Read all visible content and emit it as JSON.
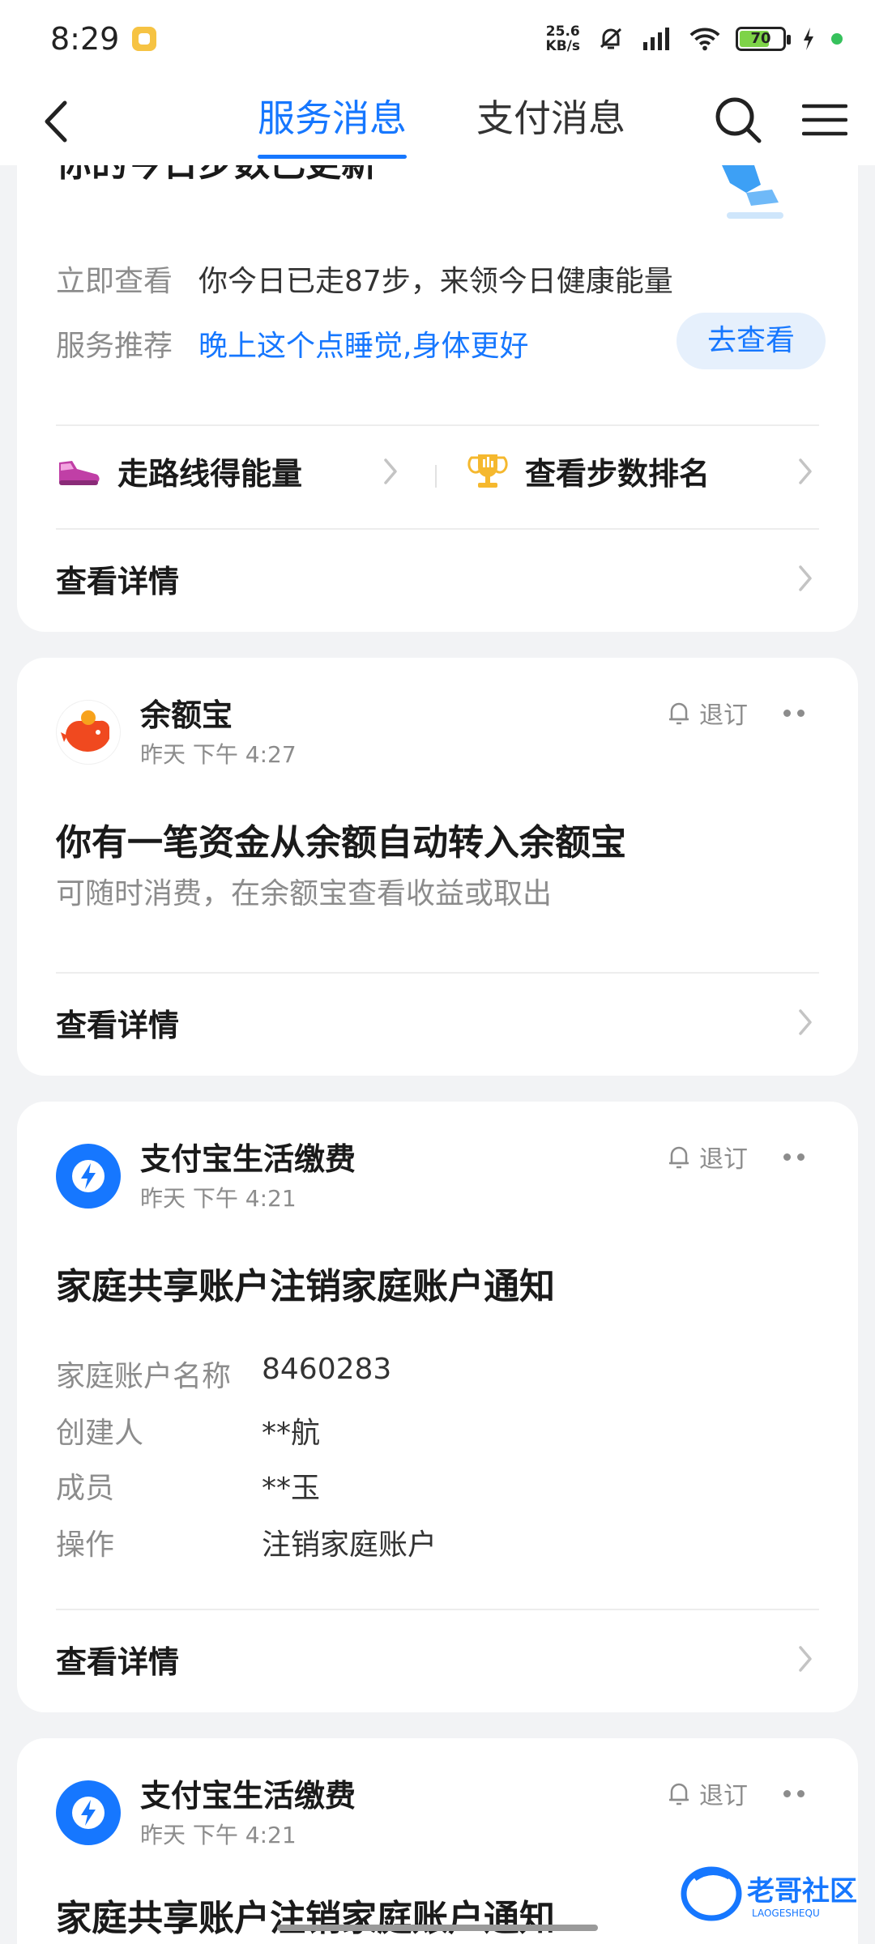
{
  "status_bar": {
    "time": "8:29",
    "net_speed_value": "25.6",
    "net_speed_unit": "KB/s",
    "battery": "70"
  },
  "header": {
    "tabs": [
      {
        "label": "服务消息",
        "active": true
      },
      {
        "label": "支付消息",
        "active": false
      }
    ]
  },
  "card_steps": {
    "title": "你的今日步数已更新",
    "rows": [
      {
        "key": "立即查看",
        "value": "你今日已走87步，来领今日健康能量"
      },
      {
        "key": "服务推荐",
        "value": "晚上这个点睡觉,身体更好"
      }
    ],
    "button": "去查看",
    "shortcuts": [
      {
        "label": "走路线得能量",
        "icon": "sneaker-icon"
      },
      {
        "label": "查看步数排名",
        "icon": "trophy-icon"
      }
    ],
    "detail": "查看详情"
  },
  "card_yuebao": {
    "brand": "余额宝",
    "time": "昨天 下午 4:27",
    "unsubscribe": "退订",
    "title": "你有一笔资金从余额自动转入余额宝",
    "subtitle": "可随时消费，在余额宝查看收益或取出",
    "detail": "查看详情"
  },
  "card_family": {
    "brand": "支付宝生活缴费",
    "time": "昨天 下午 4:21",
    "unsubscribe": "退订",
    "title": "家庭共享账户注销家庭账户通知",
    "fields": [
      {
        "key": "家庭账户名称",
        "value": "8460283"
      },
      {
        "key": "创建人",
        "value": "**航"
      },
      {
        "key": "成员",
        "value": "**玉"
      },
      {
        "key": "操作",
        "value": "注销家庭账户"
      }
    ],
    "detail": "查看详情"
  },
  "card_family2": {
    "brand": "支付宝生活缴费",
    "time": "昨天 下午 4:21",
    "unsubscribe": "退订",
    "title": "家庭共享账户注销家庭账户通知"
  },
  "watermark": {
    "text": "老哥社区",
    "sub": "LAOGESHEQU"
  },
  "colors": {
    "accent": "#1677ff",
    "background": "#f2f3f5",
    "secondary_text": "#8c8c8c"
  }
}
